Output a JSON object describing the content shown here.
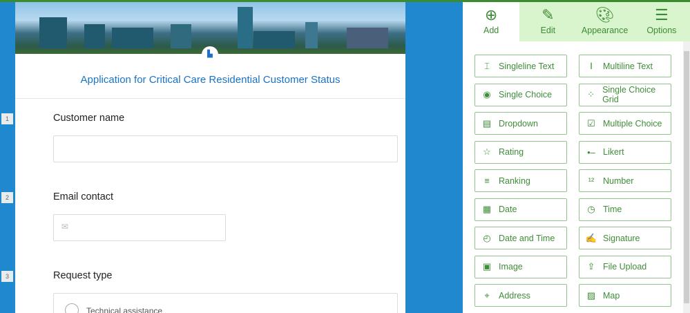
{
  "form": {
    "title": "Application for Critical Care Residential Customer Status",
    "questions": [
      {
        "num": "1",
        "label": "Customer name"
      },
      {
        "num": "2",
        "label": "Email contact"
      },
      {
        "num": "3",
        "label": "Request type"
      }
    ],
    "choice_option": "Technical assistance"
  },
  "tabs": [
    {
      "label": "Add",
      "icon": "plus-circle-icon"
    },
    {
      "label": "Edit",
      "icon": "pencil-icon"
    },
    {
      "label": "Appearance",
      "icon": "palette-icon"
    },
    {
      "label": "Options",
      "icon": "sliders-icon"
    }
  ],
  "fields": [
    {
      "label": "Singleline Text",
      "icon": "⌶"
    },
    {
      "label": "Multiline Text",
      "icon": "Ⅰ"
    },
    {
      "label": "Single Choice",
      "icon": "◉"
    },
    {
      "label": "Single Choice Grid",
      "icon": "⁘"
    },
    {
      "label": "Dropdown",
      "icon": "▤"
    },
    {
      "label": "Multiple Choice",
      "icon": "☑"
    },
    {
      "label": "Rating",
      "icon": "☆"
    },
    {
      "label": "Likert",
      "icon": "•–"
    },
    {
      "label": "Ranking",
      "icon": "≡"
    },
    {
      "label": "Number",
      "icon": "¹²"
    },
    {
      "label": "Date",
      "icon": "▦"
    },
    {
      "label": "Time",
      "icon": "◷"
    },
    {
      "label": "Date and Time",
      "icon": "◴"
    },
    {
      "label": "Signature",
      "icon": "✍"
    },
    {
      "label": "Image",
      "icon": "▣"
    },
    {
      "label": "File Upload",
      "icon": "⇪"
    },
    {
      "label": "Address",
      "icon": "⌖"
    },
    {
      "label": "Map",
      "icon": "▨"
    }
  ]
}
